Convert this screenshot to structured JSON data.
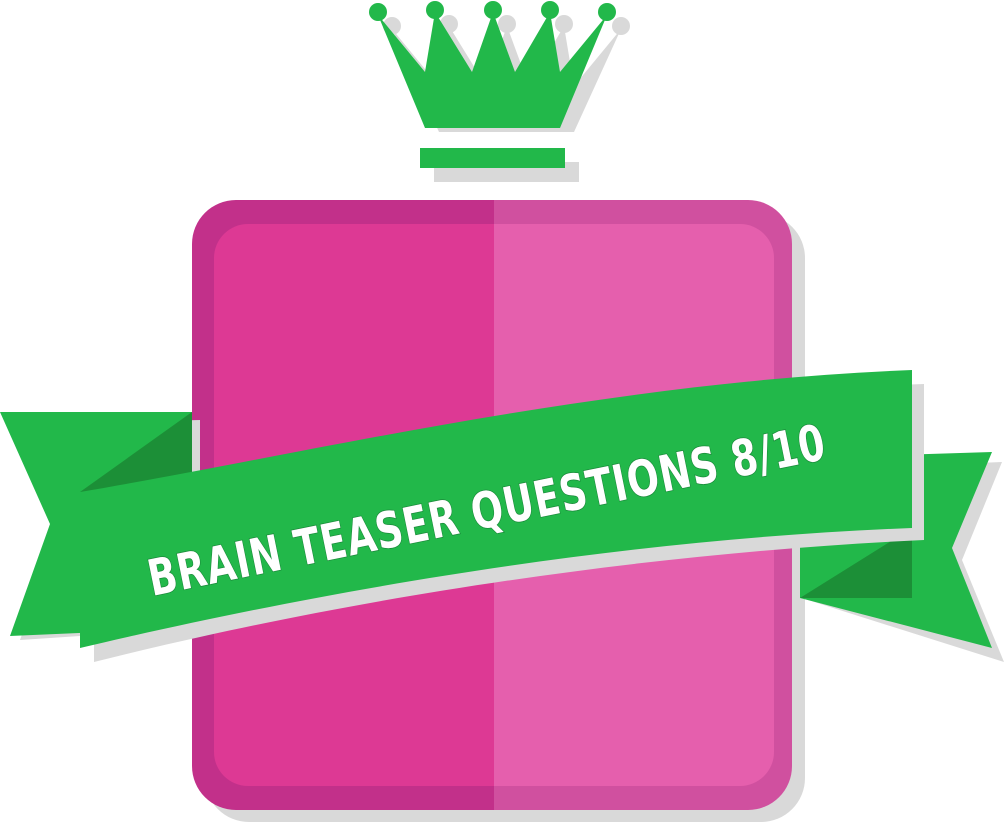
{
  "badge": {
    "banner_text": "BRAIN TEASER QUESTIONS 8/10",
    "icon": "crown-icon",
    "colors": {
      "crown": "#22b84a",
      "crown_shadow": "#dcdcdc",
      "tile_left": "#dd3994",
      "tile_right": "#e55fad",
      "tile_border_left": "#c2308a",
      "tile_border_right": "#d0509f",
      "ribbon_front": "#22b84a",
      "ribbon_back": "#1f9e3c",
      "text": "#ffffff"
    }
  }
}
